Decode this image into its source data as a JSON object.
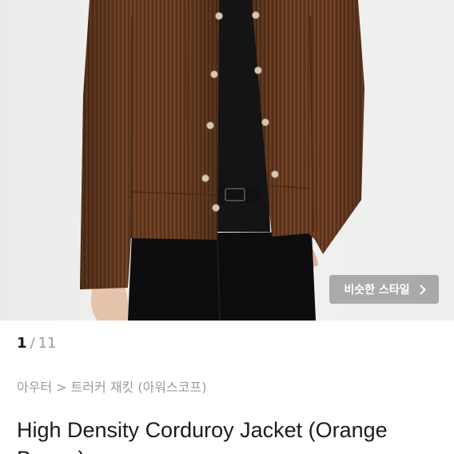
{
  "gallery": {
    "current": "1",
    "separator": "/",
    "total": "11",
    "similar_style_label": "비슷한 스타일"
  },
  "breadcrumb": {
    "category": "아우터",
    "arrow": ">",
    "subcategory": "트러커 재킷 (아워스코프)"
  },
  "product": {
    "title": "High Density Corduroy Jacket (Orange Brown)"
  },
  "colors": {
    "jacket": "#6e3f22",
    "button_overlay": "#9a9a9a"
  }
}
